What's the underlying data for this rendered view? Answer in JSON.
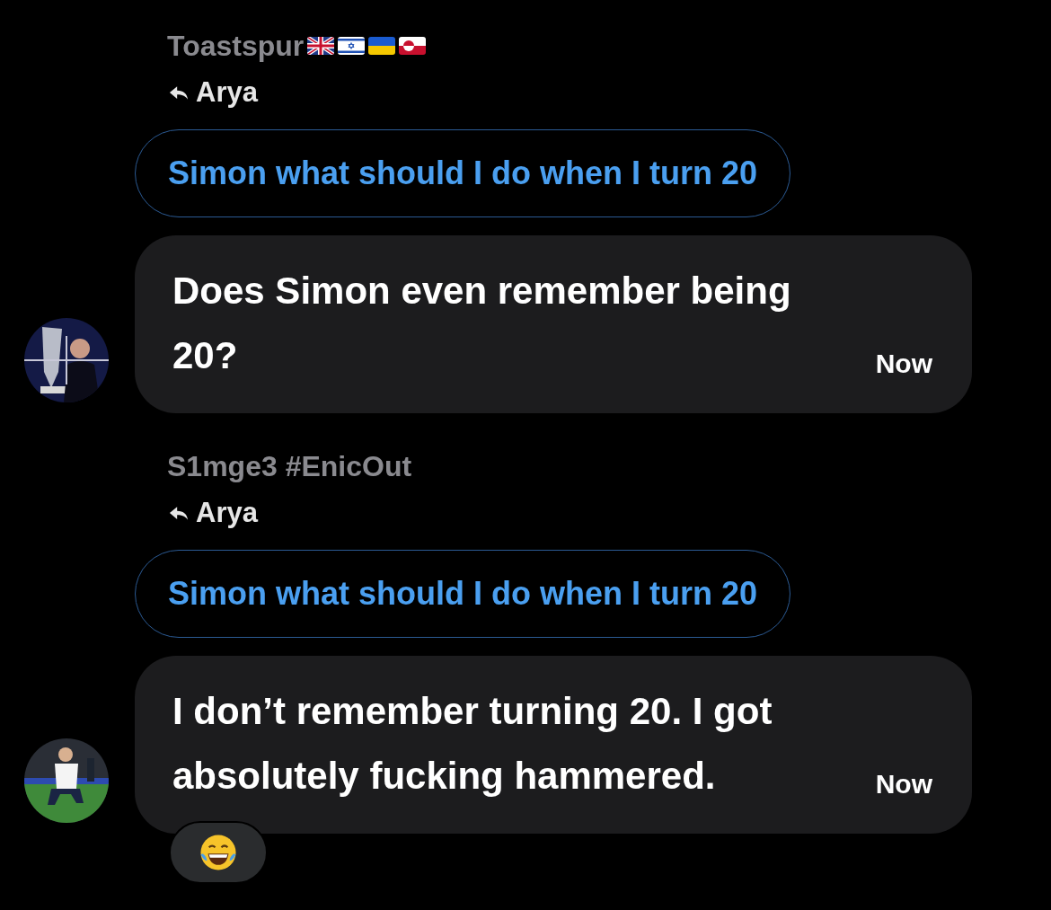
{
  "messages": [
    {
      "author": "Toastspur",
      "flags": [
        {
          "kind": "uk"
        },
        {
          "kind": "israel"
        },
        {
          "kind": "ukraine"
        },
        {
          "kind": "greenland"
        }
      ],
      "reply_to": "Arya",
      "quote": "Simon what should I do when I turn 20",
      "text": "Does Simon even remember being 20?",
      "time": "Now"
    },
    {
      "author": "S1mge3 #EnicOut",
      "reply_to": "Arya",
      "quote": "Simon what should I do when I turn 20",
      "text": "I don’t remember turning 20. I got absolutely fucking hammered.",
      "time": "Now",
      "reaction": {
        "kind": "laugh"
      }
    }
  ]
}
